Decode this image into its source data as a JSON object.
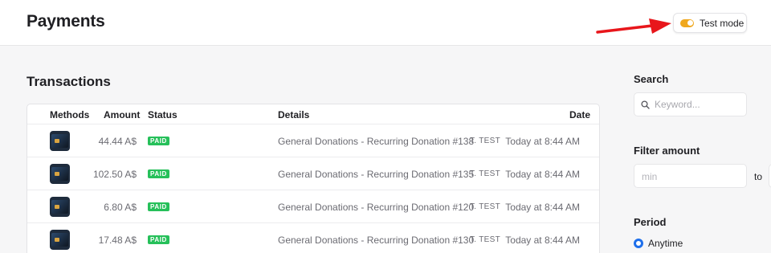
{
  "header": {
    "title": "Payments",
    "test_mode_label": "Test mode",
    "toggle_color": "#f0a81e"
  },
  "transactions": {
    "title": "Transactions",
    "columns": {
      "methods": "Methods",
      "amount": "Amount",
      "status": "Status",
      "details": "Details",
      "date": "Date"
    },
    "rows": [
      {
        "amount": "44.44 A$",
        "status": "PAID",
        "details": "General Donations - Recurring Donation #138",
        "donor": "T. TEST",
        "date": "Today at 8:44 AM"
      },
      {
        "amount": "102.50 A$",
        "status": "PAID",
        "details": "General Donations - Recurring Donation #135",
        "donor": "T. TEST",
        "date": "Today at 8:44 AM"
      },
      {
        "amount": "6.80 A$",
        "status": "PAID",
        "details": "General Donations - Recurring Donation #120",
        "donor": "T. TEST",
        "date": "Today at 8:44 AM"
      },
      {
        "amount": "17.48 A$",
        "status": "PAID",
        "details": "General Donations - Recurring Donation #130",
        "donor": "T. TEST",
        "date": "Today at 8:44 AM"
      }
    ]
  },
  "filters": {
    "search_label": "Search",
    "search_placeholder": "Keyword...",
    "amount_label": "Filter amount",
    "min_placeholder": "min",
    "to_label": "to",
    "period_label": "Period",
    "period_selected": "Anytime"
  },
  "colors": {
    "paid_badge": "#26c05a",
    "radio_accent": "#1f6feb",
    "arrow": "#e8161b"
  }
}
